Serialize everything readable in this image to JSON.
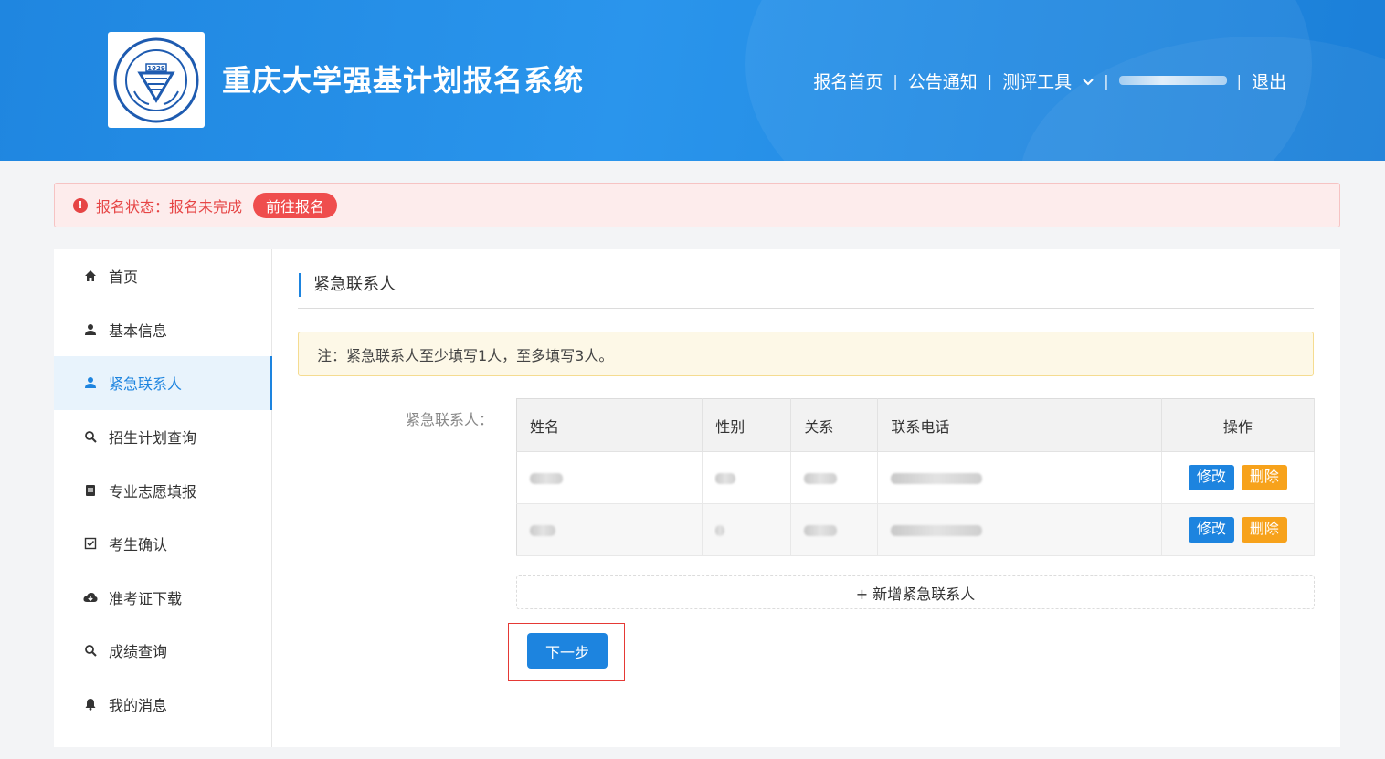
{
  "header": {
    "site_title": "重庆大学强基计划报名系统",
    "logo_text": "CHONGQING UNIVERSITY 1929",
    "nav": {
      "home": "报名首页",
      "notice": "公告通知",
      "tools": "测评工具",
      "sep": "|",
      "logout": "退出"
    }
  },
  "status": {
    "text": "报名状态：报名未完成",
    "button": "前往报名",
    "icon_color": "#e64545"
  },
  "sidebar": {
    "items": [
      {
        "label": "首页",
        "icon": "home-icon"
      },
      {
        "label": "基本信息",
        "icon": "user-icon"
      },
      {
        "label": "紧急联系人",
        "icon": "user-icon",
        "active": true
      },
      {
        "label": "招生计划查询",
        "icon": "search-icon"
      },
      {
        "label": "专业志愿填报",
        "icon": "form-icon"
      },
      {
        "label": "考生确认",
        "icon": "checkbox-icon"
      },
      {
        "label": "准考证下载",
        "icon": "cloud-download-icon"
      },
      {
        "label": "成绩查询",
        "icon": "search-icon"
      },
      {
        "label": "我的消息",
        "icon": "bell-icon"
      }
    ]
  },
  "main": {
    "section_title": "紧急联系人",
    "note": "注：紧急联系人至少填写1人，至多填写3人。",
    "field_label": "紧急联系人：",
    "table": {
      "headers": [
        "姓名",
        "性别",
        "关系",
        "联系电话",
        "操作"
      ],
      "edit_label": "修改",
      "delete_label": "删除"
    },
    "add_label": "+ 新增紧急联系人",
    "next_label": "下一步"
  },
  "colors": {
    "accent": "#1d84df",
    "danger": "#e64545",
    "warning": "#f7a21b"
  }
}
